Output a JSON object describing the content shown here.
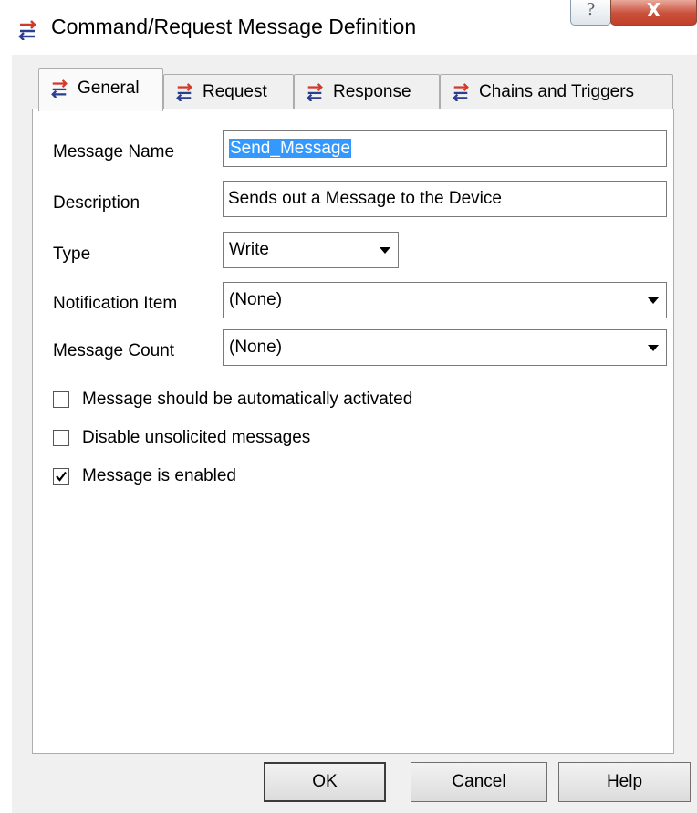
{
  "window": {
    "title": "Command/Request Message Definition",
    "icon": "arrows-exchange-icon",
    "help_glyph": "?",
    "close_glyph": "X"
  },
  "tabs": [
    {
      "label": "General",
      "icon": "arrows-exchange-icon",
      "active": true
    },
    {
      "label": "Request",
      "icon": "arrows-exchange-icon",
      "active": false
    },
    {
      "label": "Response",
      "icon": "arrows-exchange-icon",
      "active": false
    },
    {
      "label": "Chains and Triggers",
      "icon": "arrows-exchange-icon",
      "active": false
    }
  ],
  "form": {
    "message_name_label": "Message Name",
    "message_name_value": "Send_Message",
    "description_label": "Description",
    "description_value": "Sends out a Message to the Device",
    "type_label": "Type",
    "type_value": "Write",
    "notification_label": "Notification Item",
    "notification_value": "(None)",
    "count_label": "Message Count",
    "count_value": "(None)"
  },
  "checkboxes": [
    {
      "label": "Message should be automatically activated",
      "checked": false
    },
    {
      "label": "Disable unsolicited messages",
      "checked": false
    },
    {
      "label": "Message is enabled",
      "checked": true
    }
  ],
  "buttons": {
    "ok": "OK",
    "cancel": "Cancel",
    "help": "Help"
  },
  "colors": {
    "selection": "#3399ff",
    "arrow_red": "#d23a2a",
    "arrow_blue": "#2a3f8f"
  }
}
